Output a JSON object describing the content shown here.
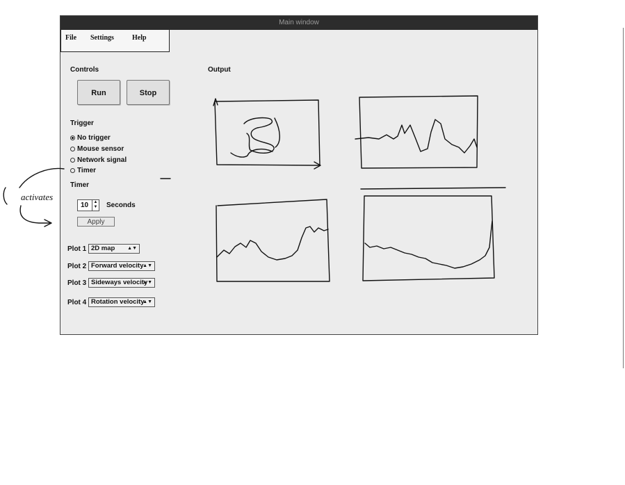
{
  "window": {
    "title": "Main window"
  },
  "menu": {
    "items": [
      "File",
      "Settings",
      "Help"
    ]
  },
  "controls": {
    "label": "Controls",
    "run": "Run",
    "stop": "Stop"
  },
  "trigger": {
    "label": "Trigger",
    "options": [
      "No trigger",
      "Mouse sensor",
      "Network signal",
      "Timer"
    ],
    "selected": "No trigger"
  },
  "timer": {
    "label": "Timer",
    "value": "10",
    "unit": "Seconds",
    "apply": "Apply"
  },
  "plots": [
    {
      "label": "Plot 1",
      "value": "2D map"
    },
    {
      "label": "Plot 2",
      "value": "Forward velocity"
    },
    {
      "label": "Plot 3",
      "value": "Sideways velocity"
    },
    {
      "label": "Plot 4",
      "value": "Rotation velocity"
    }
  ],
  "output": {
    "label": "Output"
  },
  "annotation": {
    "text": "activates"
  }
}
